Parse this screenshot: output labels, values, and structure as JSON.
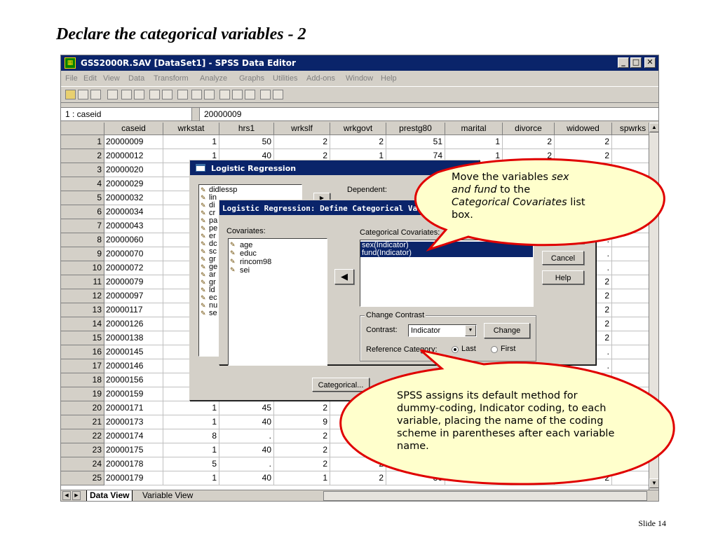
{
  "slide": {
    "title": "Declare the categorical variables - 2",
    "slide_number": "Slide 14"
  },
  "window": {
    "title": "GSS2000R.SAV [DataSet1] - SPSS Data Editor",
    "minimize": "_",
    "maximize": "□",
    "close": "✕"
  },
  "menu": [
    "File",
    "Edit",
    "View",
    "Data",
    "Transform",
    "Analyze",
    "Graphs",
    "Utilities",
    "Add-ons",
    "Window",
    "Help"
  ],
  "cell_editor": {
    "cell_ref": "1 : caseid",
    "cell_value": "20000009"
  },
  "grid": {
    "columns": [
      "caseid",
      "wrkstat",
      "hrs1",
      "wrkslf",
      "wrkgovt",
      "prestg80",
      "marital",
      "divorce",
      "widowed",
      "spwrks"
    ],
    "rows": [
      [
        "1",
        "20000009",
        "1",
        "50",
        "2",
        "2",
        "51",
        "1",
        "2",
        "2",
        ""
      ],
      [
        "2",
        "20000012",
        "1",
        "40",
        "2",
        "1",
        "74",
        "1",
        "2",
        "2",
        ""
      ],
      [
        "3",
        "20000020",
        "",
        "",
        "",
        "",
        "",
        "",
        "",
        "",
        ""
      ],
      [
        "4",
        "20000029",
        "",
        "",
        "",
        "",
        "",
        "",
        "",
        "",
        ""
      ],
      [
        "5",
        "20000032",
        "",
        "",
        "",
        "",
        "",
        "",
        "",
        "",
        ""
      ],
      [
        "6",
        "20000034",
        "",
        "",
        "",
        "",
        "",
        "",
        "",
        "",
        ""
      ],
      [
        "7",
        "20000043",
        "",
        "",
        "",
        "",
        "",
        "",
        "",
        "2",
        ""
      ],
      [
        "8",
        "20000060",
        "",
        "",
        "",
        "",
        "",
        "",
        "",
        ".",
        ""
      ],
      [
        "9",
        "20000070",
        "",
        "",
        "",
        "",
        "",
        "",
        "",
        ".",
        ""
      ],
      [
        "10",
        "20000072",
        "",
        "",
        "",
        "",
        "",
        "",
        "",
        ".",
        ""
      ],
      [
        "11",
        "20000079",
        "",
        "",
        "",
        "",
        "",
        "",
        "",
        "2",
        ""
      ],
      [
        "12",
        "20000097",
        "",
        "",
        "",
        "",
        "",
        "",
        "",
        "2",
        ""
      ],
      [
        "13",
        "20000117",
        "",
        "",
        "",
        "",
        "",
        "",
        "",
        "2",
        ""
      ],
      [
        "14",
        "20000126",
        "",
        "",
        "",
        "",
        "",
        "",
        "",
        "2",
        ""
      ],
      [
        "15",
        "20000138",
        "",
        "",
        "",
        "",
        "",
        "",
        "",
        "2",
        ""
      ],
      [
        "16",
        "20000145",
        "",
        "",
        "",
        "",
        "",
        "",
        "",
        ".",
        ""
      ],
      [
        "17",
        "20000146",
        "",
        "",
        "",
        "",
        "",
        "",
        "",
        ".",
        ""
      ],
      [
        "18",
        "20000156",
        "",
        "",
        "",
        "",
        "",
        "",
        "",
        "",
        ""
      ],
      [
        "19",
        "20000159",
        "",
        "",
        "",
        "",
        "",
        "",
        "",
        "",
        ""
      ],
      [
        "20",
        "20000171",
        "1",
        "45",
        "2",
        "",
        "",
        "",
        "",
        "",
        ""
      ],
      [
        "21",
        "20000173",
        "1",
        "40",
        "9",
        "",
        "",
        "",
        "",
        "",
        ""
      ],
      [
        "22",
        "20000174",
        "8",
        ".",
        "2",
        "",
        "",
        "",
        "",
        "",
        ""
      ],
      [
        "23",
        "20000175",
        "1",
        "40",
        "2",
        "",
        "",
        "",
        "",
        "",
        ""
      ],
      [
        "24",
        "20000178",
        "5",
        ".",
        "2",
        "2",
        "",
        "",
        "",
        "",
        ""
      ],
      [
        "25",
        "20000179",
        "1",
        "40",
        "1",
        "2",
        "36",
        "1",
        "2",
        "2",
        ""
      ]
    ]
  },
  "tabs": {
    "data_view": "Data View",
    "variable_view": "Variable View"
  },
  "logreg_dialog": {
    "title": "Logistic Regression",
    "dependent_label": "Dependent:",
    "variables": [
      "didlessp",
      "lin",
      "di",
      "cr",
      "pa",
      "pe",
      "er",
      "dc",
      "sc",
      "gr",
      "ge",
      "ar",
      "gr",
      "ld",
      "ec",
      "nu",
      "se"
    ],
    "categorical_button": "Categorical..."
  },
  "catvar_dialog": {
    "title": "Logistic Regression: Define Categorical Variables",
    "covariates_label": "Covariates:",
    "covariates": [
      "age",
      "educ",
      "rincom98",
      "sei"
    ],
    "move_arrow": "◀",
    "categorical_covariates_label": "Categorical Covariates:",
    "categorical_covariates": [
      "sex(Indicator)",
      "fund(Indicator)"
    ],
    "buttons": {
      "continue": "Continue",
      "cancel": "Cancel",
      "help": "Help",
      "change": "Change"
    },
    "change_contrast": {
      "group_label": "Change Contrast",
      "contrast_label": "Contrast:",
      "contrast_value": "Indicator",
      "reference_label": "Reference Category:",
      "last_label": "Last",
      "first_label": "First",
      "selected": "Last"
    }
  },
  "callouts": {
    "top": {
      "line1": "Move the variables ",
      "em1": "sex",
      "line2a": "and fund",
      "line2b": " to the",
      "em2": "Categorical Covariates",
      "line3b": " list",
      "line4": "box."
    },
    "bottom": {
      "text": "SPSS assigns its default method for dummy-coding, Indicator coding, to each variable, placing the name of the coding scheme in parentheses after each variable name."
    }
  },
  "colors": {
    "title_bar": "#0a246a",
    "callout_fill": "#ffffcc",
    "callout_border": "#e00000",
    "selection": "#0a246a"
  }
}
